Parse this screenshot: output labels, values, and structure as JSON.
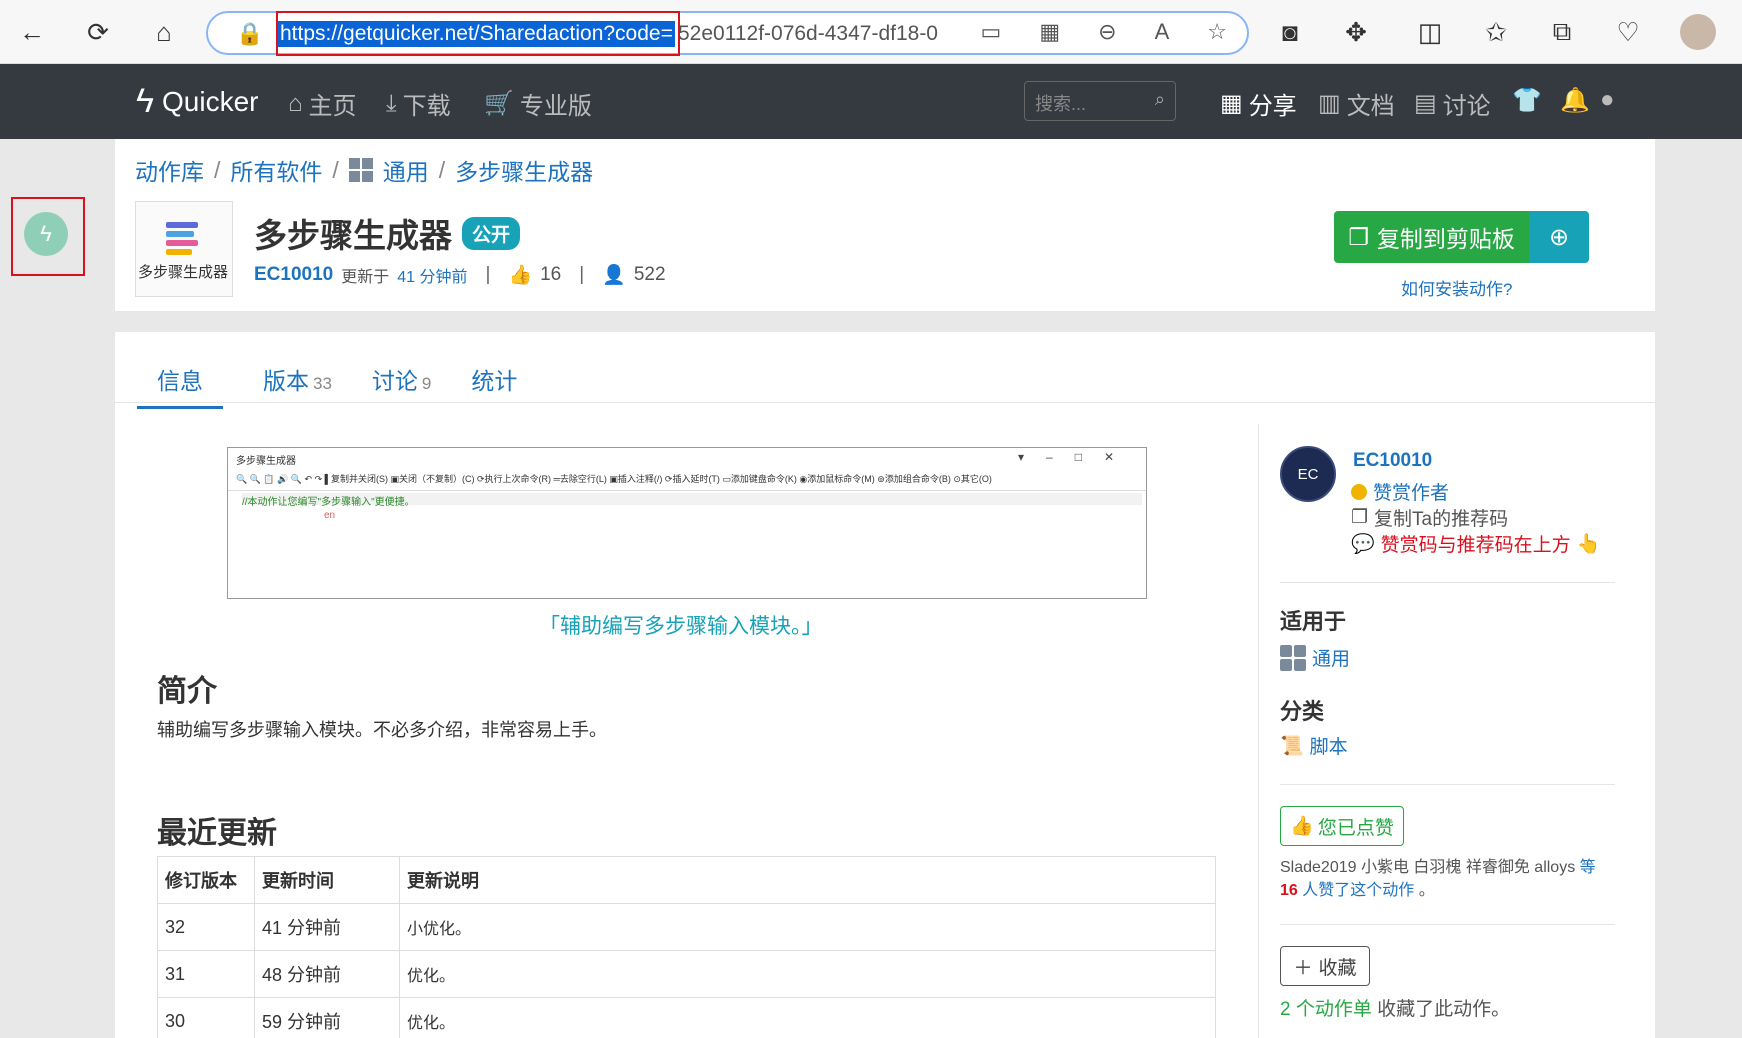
{
  "browser": {
    "url_selected": "https://getquicker.net/Sharedaction?code=",
    "url_rest": "52e0112f-076d-4347-df18-0"
  },
  "nav": {
    "brand": "Quicker",
    "home": "主页",
    "download": "下载",
    "pro": "专业版",
    "search_placeholder": "搜索...",
    "share": "分享",
    "docs": "文档",
    "discuss": "讨论"
  },
  "breadcrumb": {
    "lib": "动作库",
    "all_software": "所有软件",
    "general": "通用",
    "current": "多步骤生成器"
  },
  "action": {
    "thumb_caption": "多步骤生成器",
    "title": "多步骤生成器",
    "badge": "公开",
    "author": "EC10010",
    "updated_prefix": "更新于",
    "updated_time": "41 分钟前",
    "likes": "16",
    "users": "522",
    "copy_label": "复制到剪贴板",
    "howto": "如何安装动作?"
  },
  "tabs": [
    {
      "label": "信息",
      "count": ""
    },
    {
      "label": "版本",
      "count": "33"
    },
    {
      "label": "讨论",
      "count": "9"
    },
    {
      "label": "统计",
      "count": ""
    }
  ],
  "screenshot": {
    "title": "多步骤生成器",
    "toolbar": "🔍 🔍 📋 🔊 🔍 ↶ ↷  ▌复制并关闭(S)  ▣关闭（不复制）(C)  ⟳执行上次命令(R)  ═去除空行(L)  ▣插入注释(/)  ⟳插入延时(T)  ▭添加键盘命令(K)  ◉添加鼠标命令(M)  ⊚添加组合命令(B)  ⊙其它(O)",
    "comment": "//本动作让您编写\"多步骤输入\"更便捷。",
    "en": "en"
  },
  "caption": "「辅助编写多步骤输入模块。」",
  "intro": {
    "heading": "简介",
    "text": "辅助编写多步骤输入模块。不必多介绍，非常容易上手。"
  },
  "recent": {
    "heading": "最近更新",
    "headers": [
      "修订版本",
      "更新时间",
      "更新说明"
    ],
    "rows": [
      [
        "32",
        "41 分钟前",
        "小优化。"
      ],
      [
        "31",
        "48 分钟前",
        "优化。"
      ],
      [
        "30",
        "59 分钟前",
        "优化。"
      ]
    ]
  },
  "sidebar": {
    "avatar": "EC",
    "author": "EC10010",
    "sponsor": "赞赏作者",
    "copy_ref": "复制Ta的推荐码",
    "notice": "赞赏码与推荐码在上方",
    "applies_heading": "适用于",
    "applies_value": "通用",
    "category_heading": "分类",
    "category_value": "脚本",
    "liked_label": "您已点赞",
    "likers_names": "Slade2019 小紫电 白羽槐 祥睿御免 alloys",
    "likers_etc": "等",
    "likers_count": "16",
    "likers_suffix": "人赞了这个动作",
    "likers_end": "。",
    "fav_label": "收藏",
    "fav_count": "2 个动作单",
    "fav_suffix": "收藏了此动作。"
  }
}
